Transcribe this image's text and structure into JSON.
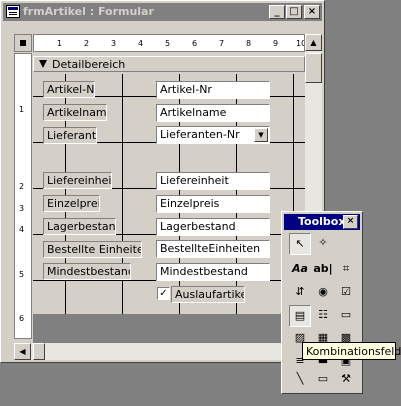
{
  "window": {
    "title": "frmArtikel : Formular",
    "minimize": "_",
    "maximize": "□",
    "close": "×"
  },
  "ruler": {
    "h_marks": [
      "1",
      "2",
      "3",
      "4",
      "5",
      "6",
      "7",
      "8",
      "9",
      "10"
    ],
    "v_marks": [
      "1",
      "2",
      "3",
      "4",
      "5",
      "6"
    ]
  },
  "section": {
    "label": "Detailbereich"
  },
  "fields": [
    {
      "label": "Artikel-Nr:",
      "control": "Artikel-Nr"
    },
    {
      "label": "Artikelname:",
      "control": "Artikelname"
    },
    {
      "label": "Lieferant:",
      "control": "Lieferanten-Nr"
    },
    {
      "label": "Liefereinheit:",
      "control": "Liefereinheit"
    },
    {
      "label": "Einzelpreis:",
      "control": "Einzelpreis"
    },
    {
      "label": "Lagerbestand:",
      "control": "Lagerbestand"
    },
    {
      "label": "Bestellte Einheiten:",
      "control": "BestellteEinheiten"
    },
    {
      "label": "Mindestbestand:",
      "control": "Mindestbestand"
    }
  ],
  "checkbox": {
    "label": "Auslaufartikel",
    "checked": true,
    "mark": "✓"
  },
  "combo_arrow": "▼",
  "toolbox": {
    "title": "Toolbox",
    "close": "×",
    "tools": [
      {
        "name": "pointer-tool",
        "glyph": "↖"
      },
      {
        "name": "wizard-tool",
        "glyph": "✧"
      },
      {
        "name": "label-tool",
        "glyph": "Aa"
      },
      {
        "name": "textbox-tool",
        "glyph": "ab|"
      },
      {
        "name": "option-group-tool",
        "glyph": "⌗"
      },
      {
        "name": "toggle-button-tool",
        "glyph": "⇵"
      },
      {
        "name": "option-button-tool",
        "glyph": "◉"
      },
      {
        "name": "checkbox-tool",
        "glyph": "☑"
      },
      {
        "name": "combobox-tool",
        "glyph": "▤"
      },
      {
        "name": "listbox-tool",
        "glyph": "☷"
      },
      {
        "name": "command-button-tool",
        "glyph": "▭"
      },
      {
        "name": "image-tool",
        "glyph": "▨"
      },
      {
        "name": "unbound-object-tool",
        "glyph": "▦"
      },
      {
        "name": "bound-object-tool",
        "glyph": "▩"
      },
      {
        "name": "page-break-tool",
        "glyph": "≡"
      },
      {
        "name": "tab-control-tool",
        "glyph": "▬"
      },
      {
        "name": "subform-tool",
        "glyph": "▣"
      },
      {
        "name": "line-tool",
        "glyph": "╲"
      },
      {
        "name": "rectangle-tool",
        "glyph": "▭"
      },
      {
        "name": "more-controls-tool",
        "glyph": "⚒"
      }
    ]
  },
  "tooltip": {
    "text": "Kombinationsfeld"
  }
}
